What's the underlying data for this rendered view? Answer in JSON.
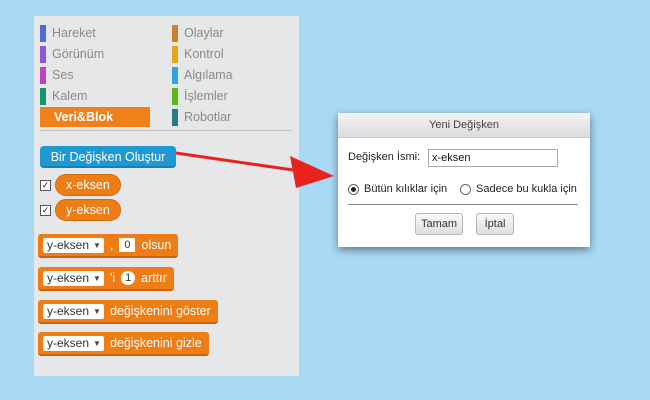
{
  "palette": {
    "categories": [
      {
        "label": "Hareket",
        "color": "#4a6cd4"
      },
      {
        "label": "Görünüm",
        "color": "#8a55d7"
      },
      {
        "label": "Ses",
        "color": "#bb42c3"
      },
      {
        "label": "Kalem",
        "color": "#0e9a6c"
      },
      {
        "label": "Veri&Blok",
        "color": "#f0801a",
        "active": true
      },
      {
        "label": "Olaylar",
        "color": "#c88330"
      },
      {
        "label": "Kontrol",
        "color": "#e1a91a"
      },
      {
        "label": "Algılama",
        "color": "#2ca5e2"
      },
      {
        "label": "İşlemler",
        "color": "#5cb712"
      },
      {
        "label": "Robotlar",
        "color": "#24788f"
      }
    ],
    "make_variable": "Bir Değişken Oluştur",
    "variables": [
      {
        "name": "x-eksen",
        "checked": "✓"
      },
      {
        "name": "y-eksen",
        "checked": "✓"
      }
    ],
    "blocks": {
      "set": {
        "var": "y-eksen",
        "comma": ",",
        "value": "0",
        "suffix": "olsun"
      },
      "change": {
        "var": "y-eksen",
        "prefix": "'i",
        "value": "1",
        "suffix": "arttır"
      },
      "show": {
        "var": "y-eksen",
        "suffix": "değişkenini göster"
      },
      "hide": {
        "var": "y-eksen",
        "suffix": "değişkenini gizle"
      }
    }
  },
  "dialog": {
    "title": "Yeni Değişken",
    "name_label": "Değişken İsmi:",
    "name_value": "x-eksen",
    "radio_all": "Bütün kılıklar için",
    "radio_this": "Sadece bu kukla için",
    "ok": "Tamam",
    "cancel": "İptal"
  },
  "arrow_color": "#e8231f"
}
